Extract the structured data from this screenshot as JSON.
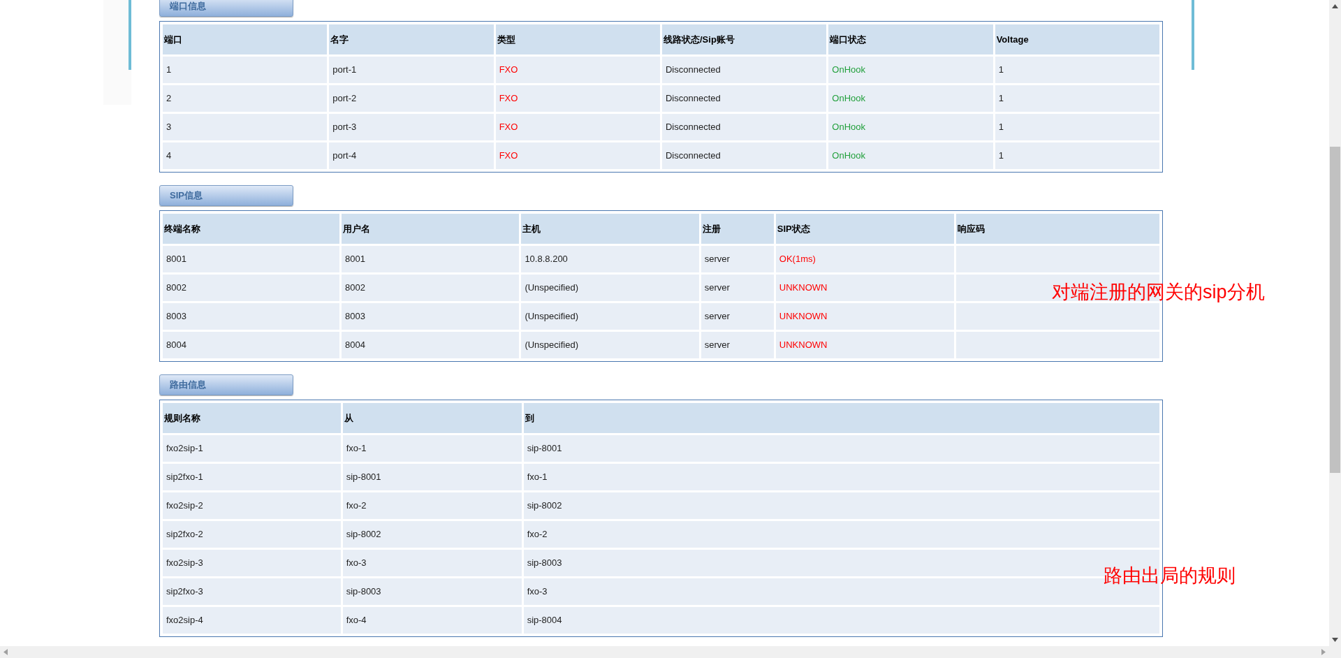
{
  "sections": [
    {
      "title": "端口信息",
      "columns": [
        {
          "label": "端口"
        },
        {
          "label": "名字"
        },
        {
          "label": "类型",
          "color": "#ff0000"
        },
        {
          "label": "线路状态/Sip账号"
        },
        {
          "label": "端口状态",
          "color": "#22a03c"
        },
        {
          "label": "Voltage"
        }
      ],
      "rows": [
        [
          "1",
          "port-1",
          "FXO",
          "Disconnected",
          "OnHook",
          "1"
        ],
        [
          "2",
          "port-2",
          "FXO",
          "Disconnected",
          "OnHook",
          "1"
        ],
        [
          "3",
          "port-3",
          "FXO",
          "Disconnected",
          "OnHook",
          "1"
        ],
        [
          "4",
          "port-4",
          "FXO",
          "Disconnected",
          "OnHook",
          "1"
        ]
      ]
    },
    {
      "title": "SIP信息",
      "columns": [
        {
          "label": "终端名称"
        },
        {
          "label": "用户名"
        },
        {
          "label": "主机"
        },
        {
          "label": "注册"
        },
        {
          "label": "SIP状态",
          "color": "#ff0000"
        },
        {
          "label": "响应码"
        }
      ],
      "rows": [
        [
          "8001",
          "8001",
          "10.8.8.200",
          "server",
          "OK(1ms)",
          ""
        ],
        [
          "8002",
          "8002",
          "(Unspecified)",
          "server",
          "UNKNOWN",
          ""
        ],
        [
          "8003",
          "8003",
          "(Unspecified)",
          "server",
          "UNKNOWN",
          ""
        ],
        [
          "8004",
          "8004",
          "(Unspecified)",
          "server",
          "UNKNOWN",
          ""
        ]
      ]
    },
    {
      "title": "路由信息",
      "columns": [
        {
          "label": "规则名称"
        },
        {
          "label": "从"
        },
        {
          "label": "到"
        }
      ],
      "rows": [
        [
          "fxo2sip-1",
          "fxo-1",
          "sip-8001"
        ],
        [
          "sip2fxo-1",
          "sip-8001",
          "fxo-1"
        ],
        [
          "fxo2sip-2",
          "fxo-2",
          "sip-8002"
        ],
        [
          "sip2fxo-2",
          "sip-8002",
          "fxo-2"
        ],
        [
          "fxo2sip-3",
          "fxo-3",
          "sip-8003"
        ],
        [
          "sip2fxo-3",
          "sip-8003",
          "fxo-3"
        ],
        [
          "fxo2sip-4",
          "fxo-4",
          "sip-8004"
        ]
      ]
    }
  ],
  "annotations": [
    {
      "text": "对端注册的网关的sip分机"
    },
    {
      "text": "路由出局的规则"
    }
  ]
}
